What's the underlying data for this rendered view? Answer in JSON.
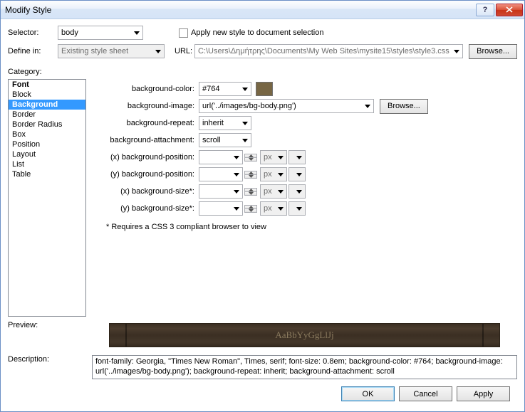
{
  "title": "Modify Style",
  "top": {
    "selector_label": "Selector:",
    "selector_value": "body",
    "apply_checkbox_label": "Apply new style to document selection",
    "definein_label": "Define in:",
    "definein_value": "Existing style sheet",
    "url_label": "URL:",
    "url_value": "C:\\Users\\Δημήτρης\\Documents\\My Web Sites\\mysite15\\styles\\style3.css",
    "browse_label": "Browse..."
  },
  "category_label": "Category:",
  "categories": [
    "Font",
    "Block",
    "Background",
    "Border",
    "Border Radius",
    "Box",
    "Position",
    "Layout",
    "List",
    "Table"
  ],
  "form": {
    "bg_color_label": "background-color:",
    "bg_color_value": "#764",
    "bg_color_hex": "#776644",
    "bg_image_label": "background-image:",
    "bg_image_value": "url('../images/bg-body.png')",
    "bg_image_browse": "Browse...",
    "bg_repeat_label": "background-repeat:",
    "bg_repeat_value": "inherit",
    "bg_attach_label": "background-attachment:",
    "bg_attach_value": "scroll",
    "bg_pos_x_label": "(x) background-position:",
    "bg_pos_y_label": "(y) background-position:",
    "bg_size_x_label": "(x) background-size*:",
    "bg_size_y_label": "(y) background-size*:",
    "unit": "px",
    "note": "* Requires a CSS 3 compliant browser to view"
  },
  "preview_label": "Preview:",
  "preview_sample": "AaBbYyGgLlJj",
  "description_label": "Description:",
  "description_text": "font-family: Georgia, \"Times New Roman\", Times, serif; font-size: 0.8em; background-color: #764; background-image: url('../images/bg-body.png'); background-repeat: inherit; background-attachment: scroll",
  "buttons": {
    "ok": "OK",
    "cancel": "Cancel",
    "apply": "Apply"
  }
}
